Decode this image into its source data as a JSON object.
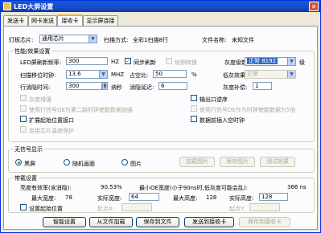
{
  "window": {
    "title": "LED大屏设置"
  },
  "tabs": [
    {
      "label": "发送卡"
    },
    {
      "label": "网卡发送"
    },
    {
      "label": "接收卡"
    },
    {
      "label": "显示屏连接"
    }
  ],
  "top": {
    "chip_label": "灯板芯片:",
    "chip_value": "通用芯片",
    "scan_label": "扫描方式:",
    "scan_value": "全彩1扫描8行",
    "file_label": "文件名称:",
    "file_value": "未知文件"
  },
  "perf": {
    "title": "性能/效果设置",
    "led_freq_label": "LED屏刷新频率:",
    "led_freq_value": "300",
    "led_freq_unit": "HZ",
    "sync_refresh_label": "同步刷新",
    "frame_convert_label": "帧频转换",
    "gray_label": "灰度级数",
    "gray_value": "正常 8192",
    "gray_unit": "级",
    "scan_clock_label": "扫描移位时钟:",
    "scan_clock_value": "13.6",
    "scan_clock_unit": "MHZ",
    "duty_label": "占空比:",
    "duty_value": "50",
    "duty_unit": "%",
    "low_gray_label": "低灰效果:",
    "low_gray_value": "正常",
    "row_blank_label": "行消隐时间:",
    "row_blank_value": "300",
    "row_blank_unit": "纳秒",
    "blank_delay_label": "消隐延迟:",
    "blank_delay_value": "6",
    "gray_comp_label": "灰度补偿:",
    "gray_comp_value": "1",
    "cb_gray_enhance": "灰度增强",
    "cb_output_reverse": "输出口逆序",
    "cb_second_signal": "使用行信号OE为第二路时钟使能数据加强",
    "cb_de_signal": "使用行信号DE作为时钟使能数据为5倍",
    "cb_expand_port": "扩展起始位置接口",
    "cb_data_insert": "数据前插入空时钟",
    "cb_chip_protect": "启用芯片温度保护"
  },
  "nosignal": {
    "title": "无信号显示",
    "opt_black": "黑屏",
    "opt_random": "随机画面",
    "opt_image": "图片",
    "btn_load": "加载图片",
    "btn_save": "保存图片",
    "btn_test": "测试效果"
  },
  "load": {
    "title": "带载设置",
    "efficiency_label": "亮度有效率(含消隐):",
    "efficiency_value": "90.53%",
    "min_oe_label": "最小OE宽度(小于90ns时,低灰度可能会乱):",
    "min_oe_value": "366 ns",
    "max_width_label": "最大宽度:",
    "max_width_value": "78",
    "actual_width_label": "实际宽度:",
    "actual_width_value": "64",
    "max_height_label": "最大高度:",
    "max_height_value": "128",
    "actual_height_label": "实际高度:",
    "actual_height_value": "128",
    "set_start_label": "设置起始位置",
    "start_x_label": "起点X:",
    "start_x_value": "",
    "start_y_label": "起点Y:",
    "start_y_value": ""
  },
  "buttons": {
    "smart": "智能设置",
    "load_file": "从文件加载",
    "save_file": "保存到文件",
    "send_card": "发送到接收卡",
    "save_card": "保存到接收卡"
  }
}
